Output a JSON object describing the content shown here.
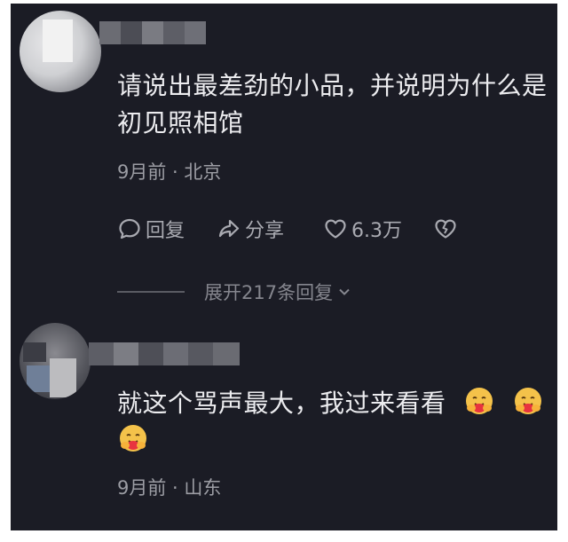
{
  "comments": [
    {
      "text": "请说出最差劲的小品，并说明为什么是初见照相馆",
      "meta": "9月前 · 北京",
      "actions": {
        "reply": "回复",
        "share": "分享",
        "likes": "6.3万"
      },
      "expand": "展开217条回复"
    },
    {
      "text": "就这个骂声最大，我过来看看",
      "emojis": [
        "hug-emoji",
        "hug-emoji",
        "hug-emoji"
      ],
      "meta": "9月前 · 山东"
    }
  ],
  "colors": {
    "background": "#1b1c25",
    "text": "#ececef",
    "meta": "#9c9da4"
  }
}
